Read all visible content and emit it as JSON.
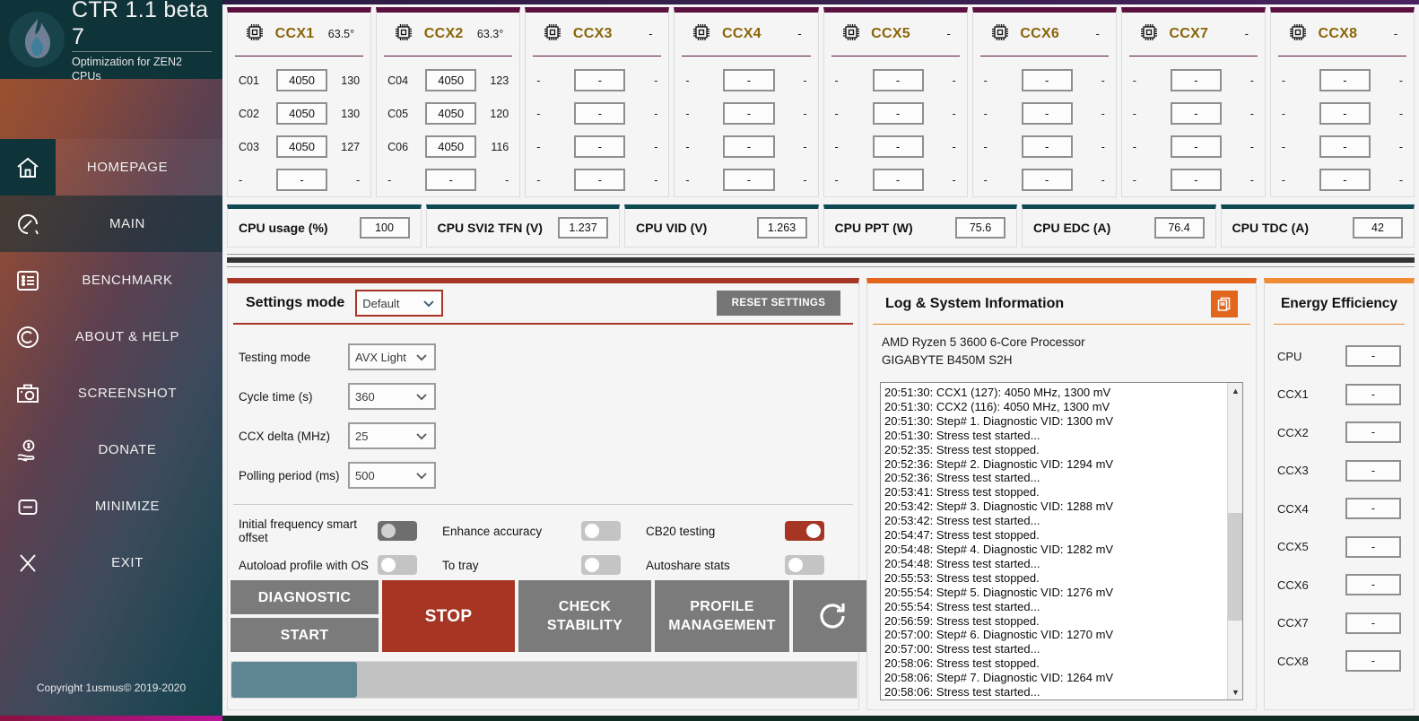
{
  "app": {
    "title": "CTR 1.1 beta 7",
    "subtitle": "Optimization for ZEN2 CPUs",
    "copyright": "Copyright 1usmus© 2019-2020"
  },
  "sidebar": {
    "items": [
      {
        "label": "HOMEPAGE",
        "icon": "home-icon",
        "active": true
      },
      {
        "label": "MAIN",
        "icon": "gauge-icon",
        "active": false
      },
      {
        "label": "BENCHMARK",
        "icon": "list-icon",
        "active": false
      },
      {
        "label": "ABOUT & HELP",
        "icon": "copyright-icon",
        "active": false
      },
      {
        "label": "SCREENSHOT",
        "icon": "camera-icon",
        "active": false
      },
      {
        "label": "DONATE",
        "icon": "donate-hand-icon",
        "active": false
      },
      {
        "label": "MINIMIZE",
        "icon": "minimize-icon",
        "active": false
      },
      {
        "label": "EXIT",
        "icon": "close-x-icon",
        "active": false
      }
    ]
  },
  "ccx_panels": [
    {
      "name": "CCX1",
      "temp": "63.5°",
      "rows": [
        {
          "core": "C01",
          "freq": "4050",
          "load": "130"
        },
        {
          "core": "C02",
          "freq": "4050",
          "load": "130"
        },
        {
          "core": "C03",
          "freq": "4050",
          "load": "127"
        },
        {
          "core": "-",
          "freq": "-",
          "load": "-"
        }
      ]
    },
    {
      "name": "CCX2",
      "temp": "63.3°",
      "rows": [
        {
          "core": "C04",
          "freq": "4050",
          "load": "123"
        },
        {
          "core": "C05",
          "freq": "4050",
          "load": "120"
        },
        {
          "core": "C06",
          "freq": "4050",
          "load": "116"
        },
        {
          "core": "-",
          "freq": "-",
          "load": "-"
        }
      ]
    },
    {
      "name": "CCX3",
      "temp": "-",
      "rows": [
        {
          "core": "-",
          "freq": "-",
          "load": "-"
        },
        {
          "core": "-",
          "freq": "-",
          "load": "-"
        },
        {
          "core": "-",
          "freq": "-",
          "load": "-"
        },
        {
          "core": "-",
          "freq": "-",
          "load": "-"
        }
      ]
    },
    {
      "name": "CCX4",
      "temp": "-",
      "rows": [
        {
          "core": "-",
          "freq": "-",
          "load": "-"
        },
        {
          "core": "-",
          "freq": "-",
          "load": "-"
        },
        {
          "core": "-",
          "freq": "-",
          "load": "-"
        },
        {
          "core": "-",
          "freq": "-",
          "load": "-"
        }
      ]
    },
    {
      "name": "CCX5",
      "temp": "-",
      "rows": [
        {
          "core": "-",
          "freq": "-",
          "load": "-"
        },
        {
          "core": "-",
          "freq": "-",
          "load": "-"
        },
        {
          "core": "-",
          "freq": "-",
          "load": "-"
        },
        {
          "core": "-",
          "freq": "-",
          "load": "-"
        }
      ]
    },
    {
      "name": "CCX6",
      "temp": "-",
      "rows": [
        {
          "core": "-",
          "freq": "-",
          "load": "-"
        },
        {
          "core": "-",
          "freq": "-",
          "load": "-"
        },
        {
          "core": "-",
          "freq": "-",
          "load": "-"
        },
        {
          "core": "-",
          "freq": "-",
          "load": "-"
        }
      ]
    },
    {
      "name": "CCX7",
      "temp": "-",
      "rows": [
        {
          "core": "-",
          "freq": "-",
          "load": "-"
        },
        {
          "core": "-",
          "freq": "-",
          "load": "-"
        },
        {
          "core": "-",
          "freq": "-",
          "load": "-"
        },
        {
          "core": "-",
          "freq": "-",
          "load": "-"
        }
      ]
    },
    {
      "name": "CCX8",
      "temp": "-",
      "rows": [
        {
          "core": "-",
          "freq": "-",
          "load": "-"
        },
        {
          "core": "-",
          "freq": "-",
          "load": "-"
        },
        {
          "core": "-",
          "freq": "-",
          "load": "-"
        },
        {
          "core": "-",
          "freq": "-",
          "load": "-"
        }
      ]
    }
  ],
  "stats": [
    {
      "label": "CPU usage (%)",
      "value": "100"
    },
    {
      "label": "CPU SVI2 TFN (V)",
      "value": "1.237"
    },
    {
      "label": "CPU VID (V)",
      "value": "1.263"
    },
    {
      "label": "CPU PPT (W)",
      "value": "75.6"
    },
    {
      "label": "CPU EDC (A)",
      "value": "76.4"
    },
    {
      "label": "CPU TDC (A)",
      "value": "42"
    }
  ],
  "settings": {
    "title": "Settings mode",
    "mode_value": "Default",
    "reset_label": "RESET SETTINGS",
    "fields": [
      {
        "label": "Testing mode",
        "value": "AVX Light"
      },
      {
        "label": "Cycle time (s)",
        "value": "360"
      },
      {
        "label": "CCX delta (MHz)",
        "value": "25"
      },
      {
        "label": "Polling period (ms)",
        "value": "500"
      }
    ],
    "toggles": [
      {
        "label": "Initial frequency smart offset",
        "state": "dark"
      },
      {
        "label": "Enhance accuracy",
        "state": "off"
      },
      {
        "label": "CB20 testing",
        "state": "on"
      },
      {
        "label": "Autoload profile with OS",
        "state": "off"
      },
      {
        "label": "To tray",
        "state": "off"
      },
      {
        "label": "Autoshare stats",
        "state": "off"
      }
    ],
    "buttons": {
      "diagnostic": "DIAGNOSTIC",
      "start": "START",
      "stop": "STOP",
      "check_stability_l1": "CHECK",
      "check_stability_l2": "STABILITY",
      "profile_l1": "PROFILE",
      "profile_l2": "MANAGEMENT",
      "refresh": "refresh-icon"
    },
    "progress_percent": "20"
  },
  "log": {
    "title": "Log & System Information",
    "copy_icon": "copy-icon",
    "cpu": "AMD Ryzen 5 3600 6-Core Processor",
    "motherboard": "GIGABYTE B450M S2H",
    "lines": [
      "20:51:30: CCX1 (127): 4050 MHz, 1300 mV",
      "20:51:30: CCX2 (116): 4050 MHz, 1300 mV",
      "20:51:30: Step# 1. Diagnostic VID: 1300 mV",
      "20:51:30: Stress test started...",
      "20:52:35: Stress test stopped.",
      "20:52:36: Step# 2. Diagnostic VID: 1294 mV",
      "20:52:36: Stress test started...",
      "20:53:41: Stress test stopped.",
      "20:53:42: Step# 3. Diagnostic VID: 1288 mV",
      "20:53:42: Stress test started...",
      "20:54:47: Stress test stopped.",
      "20:54:48: Step# 4. Diagnostic VID: 1282 mV",
      "20:54:48: Stress test started...",
      "20:55:53: Stress test stopped.",
      "20:55:54: Step# 5. Diagnostic VID: 1276 mV",
      "20:55:54: Stress test started...",
      "20:56:59: Stress test stopped.",
      "20:57:00: Step# 6. Diagnostic VID: 1270 mV",
      "20:57:00: Stress test started...",
      "20:58:06: Stress test stopped.",
      "20:58:06: Step# 7. Diagnostic VID: 1264 mV",
      "20:58:06: Stress test started..."
    ]
  },
  "energy": {
    "title": "Energy Efficiency",
    "rows": [
      {
        "label": "CPU",
        "value": "-"
      },
      {
        "label": "CCX1",
        "value": "-"
      },
      {
        "label": "CCX2",
        "value": "-"
      },
      {
        "label": "CCX3",
        "value": "-"
      },
      {
        "label": "CCX4",
        "value": "-"
      },
      {
        "label": "CCX5",
        "value": "-"
      },
      {
        "label": "CCX6",
        "value": "-"
      },
      {
        "label": "CCX7",
        "value": "-"
      },
      {
        "label": "CCX8",
        "value": "-"
      }
    ]
  },
  "colors": {
    "accent_red": "#a63523",
    "accent_orange": "#e2661c",
    "accent_orange_light": "#ef8c34",
    "ccx_header": "#5b1140",
    "ccx_title_text": "#8a6508",
    "stat_header": "#0e4a52",
    "sidebar_dark": "#0e3339",
    "progress_fill": "#5e8592"
  }
}
